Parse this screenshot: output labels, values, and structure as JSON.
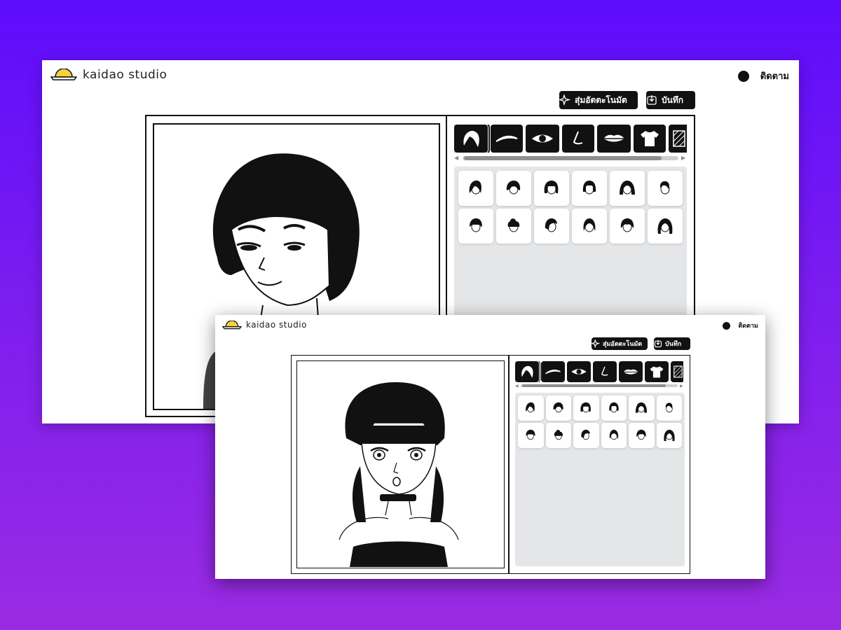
{
  "app": {
    "name": "kaidao studio"
  },
  "header": {
    "follow_label": "ติดตาม"
  },
  "toolbar": {
    "random_label": "สุ่มอัตตะโนมัต",
    "save_label": "บันทึก"
  },
  "tabs": [
    {
      "name": "hair",
      "icon": "hair-icon"
    },
    {
      "name": "eyebrows",
      "icon": "eyebrow-icon"
    },
    {
      "name": "eyes",
      "icon": "eye-icon"
    },
    {
      "name": "nose",
      "icon": "nose-icon"
    },
    {
      "name": "mouth",
      "icon": "lips-icon"
    },
    {
      "name": "clothes",
      "icon": "shirt-icon"
    },
    {
      "name": "background",
      "icon": "pattern-icon"
    }
  ],
  "hair_options": [
    "hair-style-1",
    "hair-style-2",
    "hair-style-3",
    "hair-style-4",
    "hair-style-5",
    "hair-style-6",
    "hair-style-7",
    "hair-style-8",
    "hair-style-9",
    "hair-style-10",
    "hair-style-11",
    "hair-style-12"
  ],
  "colors": {
    "background_top": "#5d0cfc",
    "background_bottom": "#9a2be3",
    "ink": "#111111",
    "panel": "#e5e6e8",
    "logo_sun": "#f5d33a"
  }
}
